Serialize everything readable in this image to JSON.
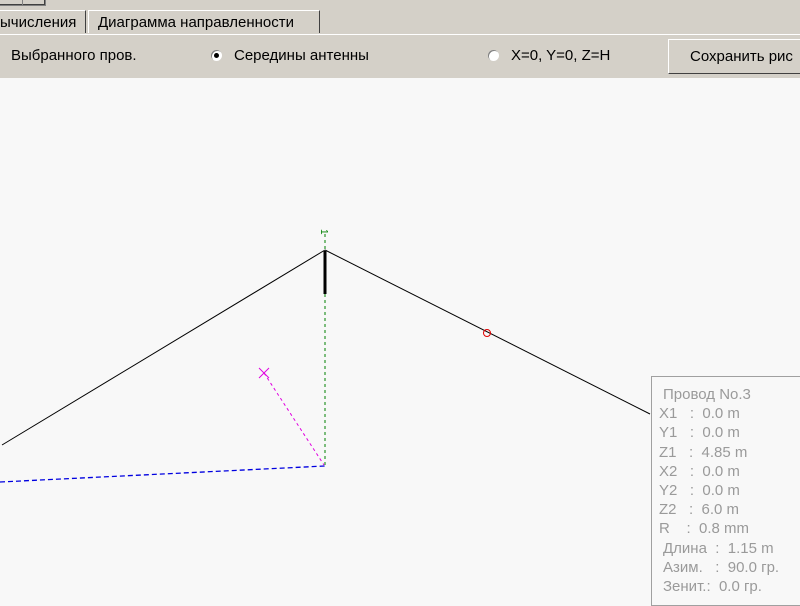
{
  "tabs": [
    {
      "label": "ычисления"
    },
    {
      "label": "Диаграмма направленности"
    }
  ],
  "options": {
    "selected_wire": "Выбранного пров.",
    "antenna_center": "Середины антенны",
    "origin": "X=0, Y=0, Z=H"
  },
  "save_button": "Сохранить рис",
  "wire_label": "1",
  "wire_info": {
    "title": "Провод No.3",
    "lines": [
      "X1   :  0.0 m",
      "Y1   :  0.0 m",
      "Z1   :  4.85 m",
      "X2   :  0.0 m",
      "Y2   :  0.0 m",
      "Z2   :  6.0 m",
      "R    :  0.8 mm"
    ],
    "length": "Длина  :  1.15 m",
    "azimuth": "Азим.   :  90.0 гр.",
    "zenith": "Зенит.:  0.0 гр."
  }
}
